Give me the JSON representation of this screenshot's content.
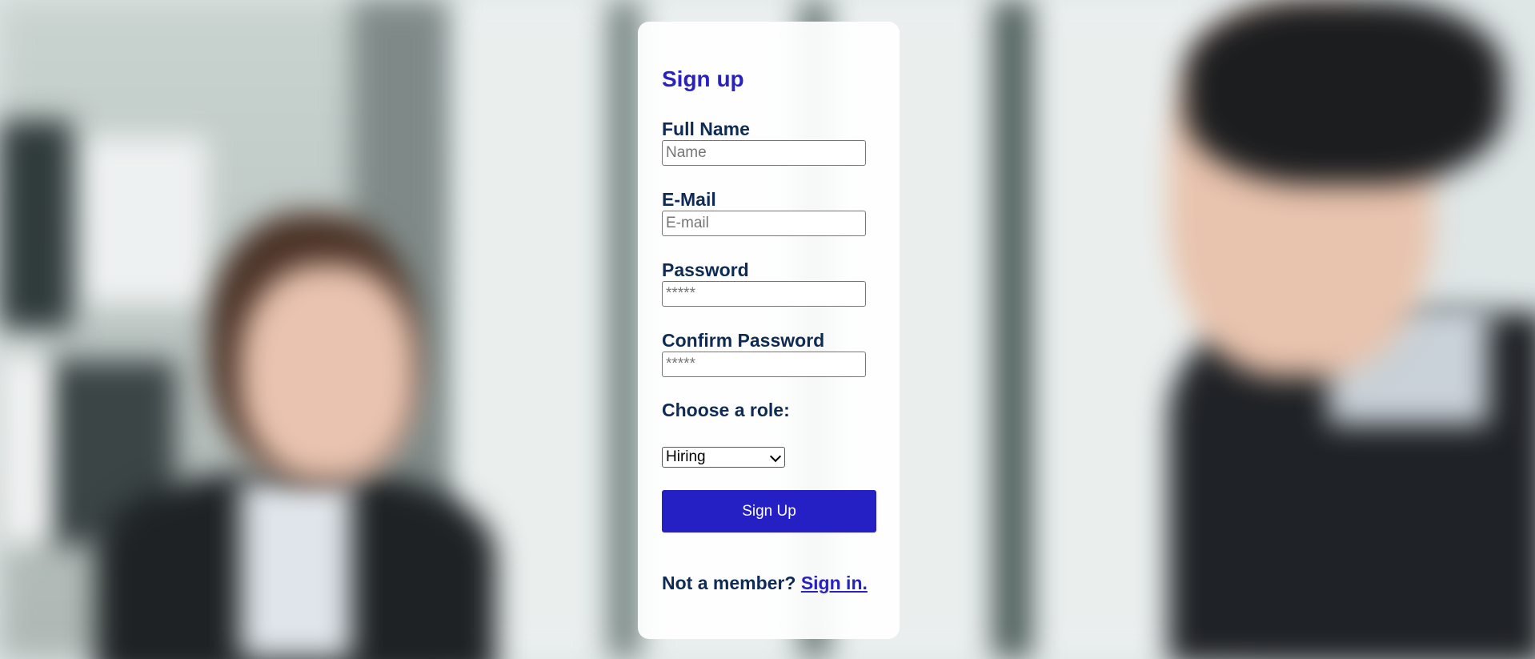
{
  "form": {
    "title": "Sign up",
    "fields": [
      {
        "label": "Full Name",
        "placeholder": "Name",
        "type": "text"
      },
      {
        "label": "E-Mail",
        "placeholder": "E-mail",
        "type": "email"
      },
      {
        "label": "Password",
        "placeholder": "*****",
        "type": "password"
      },
      {
        "label": "Confirm Password",
        "placeholder": "*****",
        "type": "password"
      }
    ],
    "role_label": "Choose a role:",
    "role_selected": "Hiring",
    "submit_label": "Sign Up",
    "footer_text": "Not a member?",
    "footer_link": "Sign in."
  },
  "colors": {
    "accent": "#2420c4",
    "heading": "#2a22c0",
    "label": "#0e2b55"
  },
  "icons": {
    "select": "chevron-down-icon"
  }
}
